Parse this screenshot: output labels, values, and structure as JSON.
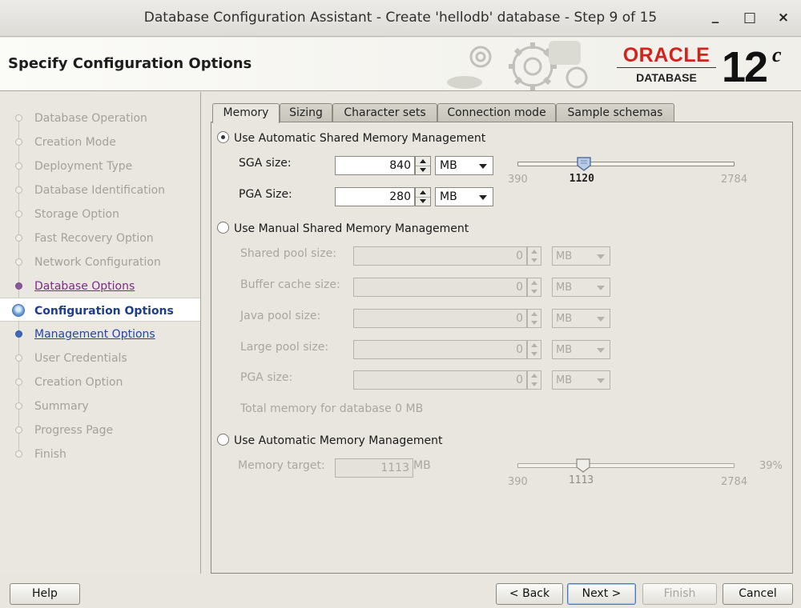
{
  "window": {
    "title": "Database Configuration Assistant - Create 'hellodb' database - Step 9 of 15",
    "minimize_label": "_",
    "maximize_label": "□",
    "close_label": "×"
  },
  "banner": {
    "heading": "Specify Configuration Options",
    "logo_word": "ORACLE",
    "logo_reg": "®",
    "logo_sub": "DATABASE",
    "version": "12",
    "version_suffix": "c"
  },
  "nav": {
    "items": [
      {
        "label": "Database Operation",
        "state": "inactive"
      },
      {
        "label": "Creation Mode",
        "state": "inactive"
      },
      {
        "label": "Deployment Type",
        "state": "inactive"
      },
      {
        "label": "Database Identification",
        "state": "inactive"
      },
      {
        "label": "Storage Option",
        "state": "inactive"
      },
      {
        "label": "Fast Recovery Option",
        "state": "inactive"
      },
      {
        "label": "Network Configuration",
        "state": "inactive"
      },
      {
        "label": "Database Options",
        "state": "done"
      },
      {
        "label": "Configuration Options",
        "state": "current"
      },
      {
        "label": "Management Options",
        "state": "next"
      },
      {
        "label": "User Credentials",
        "state": "inactive"
      },
      {
        "label": "Creation Option",
        "state": "inactive"
      },
      {
        "label": "Summary",
        "state": "inactive"
      },
      {
        "label": "Progress Page",
        "state": "inactive"
      },
      {
        "label": "Finish",
        "state": "inactive"
      }
    ]
  },
  "tabs": [
    {
      "label": "Memory"
    },
    {
      "label": "Sizing"
    },
    {
      "label": "Character sets"
    },
    {
      "label": "Connection mode"
    },
    {
      "label": "Sample schemas"
    }
  ],
  "memory": {
    "asmm_label": "Use Automatic Shared Memory Management",
    "sga_label": "SGA size:",
    "sga_value": "840",
    "sga_unit": "MB",
    "pga_label": "PGA Size:",
    "pga_value": "280",
    "pga_unit": "MB",
    "slider1": {
      "min": "390",
      "max": "2784",
      "value": "1120",
      "fraction": 0.305
    },
    "manual_label": "Use Manual Shared Memory Management",
    "manual_fields": [
      {
        "label": "Shared pool size:",
        "value": "0",
        "unit": "MB"
      },
      {
        "label": "Buffer cache size:",
        "value": "0",
        "unit": "MB"
      },
      {
        "label": "Java pool size:",
        "value": "0",
        "unit": "MB"
      },
      {
        "label": "Large pool size:",
        "value": "0",
        "unit": "MB"
      },
      {
        "label": "PGA size:",
        "value": "0",
        "unit": "MB"
      }
    ],
    "total_memory": "Total memory for database 0 MB",
    "amm_label": "Use Automatic Memory Management",
    "memory_target_label": "Memory target:",
    "memory_target_value": "1113",
    "memory_target_unit": "MB",
    "slider2": {
      "min": "390",
      "max": "2784",
      "value": "1113",
      "percent": "39%",
      "fraction": 0.302
    }
  },
  "buttons": {
    "help": "Help",
    "back": "< Back",
    "next": "Next >",
    "finish": "Finish",
    "cancel": "Cancel"
  }
}
